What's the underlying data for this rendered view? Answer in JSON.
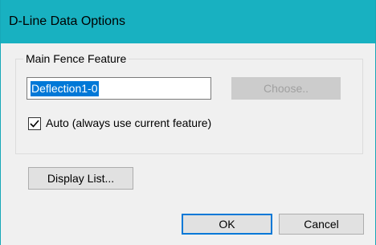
{
  "window": {
    "title": "D-Line Data Options"
  },
  "group": {
    "legend": "Main Fence Feature"
  },
  "feature": {
    "value": "Deflection1-0"
  },
  "buttons": {
    "choose": "Choose..",
    "display_list": "Display List...",
    "ok": "OK",
    "cancel": "Cancel"
  },
  "auto_option": {
    "label": "Auto (always use current feature)",
    "checked": true
  },
  "colors": {
    "titlebar": "#18b1c1",
    "selection": "#0078d7",
    "default_button_border": "#0078d7"
  }
}
